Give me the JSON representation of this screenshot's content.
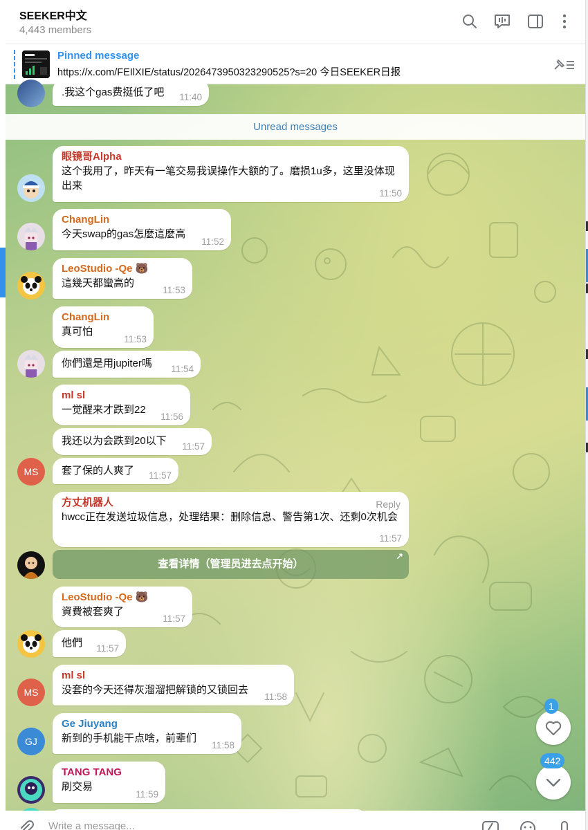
{
  "header": {
    "title": "SEEKER中文",
    "members": "4,443 members",
    "icons": [
      "search-icon",
      "voice-chat-icon",
      "sidebar-icon",
      "more-icon"
    ]
  },
  "pinned": {
    "title": "Pinned message",
    "text": "https://x.com/FEIlXIE/status/2026473950323290525?s=20  今日SEEKER日报"
  },
  "unread_label": "Unread messages",
  "messages": [
    {
      "text": ".我这个gas费挺低了吧",
      "time": "11:40"
    },
    {
      "name": "眼镜哥Alpha",
      "name_color": "#c0392b",
      "text": "这个我用了，昨天有一笔交易我误操作大额的了。磨损1u多，这里没体现出来",
      "time": "11:50"
    },
    {
      "name": "ChangLin",
      "name_color": "#d46a1f",
      "text": "今天swap的gas怎麼這麼高",
      "time": "11:52"
    },
    {
      "name": "LeoStudio -Qe 🐻",
      "name_color": "#d46a1f",
      "text": "這幾天都蠻高的",
      "time": "11:53"
    },
    {
      "name": "ChangLin",
      "name_color": "#d46a1f",
      "text": "真可怕",
      "time": "11:53"
    },
    {
      "text": "你們還是用jupiter嗎",
      "time": "11:54"
    },
    {
      "name": "ml sl",
      "name_color": "#c0392b",
      "text": "一觉醒来才跌到22",
      "time": "11:56"
    },
    {
      "text": "我还以为会跌到20以下",
      "time": "11:57"
    },
    {
      "text": "套了保的人爽了",
      "time": "11:57",
      "avatar": "MS"
    },
    {
      "name": "方丈机器人",
      "name_color": "#c0392b",
      "reply": "Reply",
      "text": "hwcc正在发送垃圾信息，处理结果：删除信息、警告第1次、还剩0次机会",
      "time": "11:57",
      "button": "查看详情（管理员进去点开始）"
    },
    {
      "name": "LeoStudio -Qe 🐻",
      "name_color": "#d46a1f",
      "text": "資費被套爽了",
      "time": "11:57"
    },
    {
      "text": "他們",
      "time": "11:57"
    },
    {
      "name": "ml sl",
      "name_color": "#c0392b",
      "text": "没套的今天还得灰溜溜把解锁的又锁回去",
      "time": "11:58",
      "avatar": "MS"
    },
    {
      "name": "Ge Jiuyang",
      "name_color": "#2a7fc1",
      "text": "新到的手机能干点啥，前辈们",
      "time": "11:58",
      "avatar": "GJ"
    },
    {
      "name": "TANG TANG",
      "name_color": "#c2185b",
      "text": "刷交易",
      "time": "11:59"
    }
  ],
  "colors": {
    "accent": "#3390ec",
    "avatar_ms": "#e0614a",
    "avatar_gj": "#3a8ad6"
  },
  "floating": {
    "reactions_badge": "1",
    "unread_badge": "442"
  },
  "composer": {
    "placeholder": "Write a message..."
  }
}
